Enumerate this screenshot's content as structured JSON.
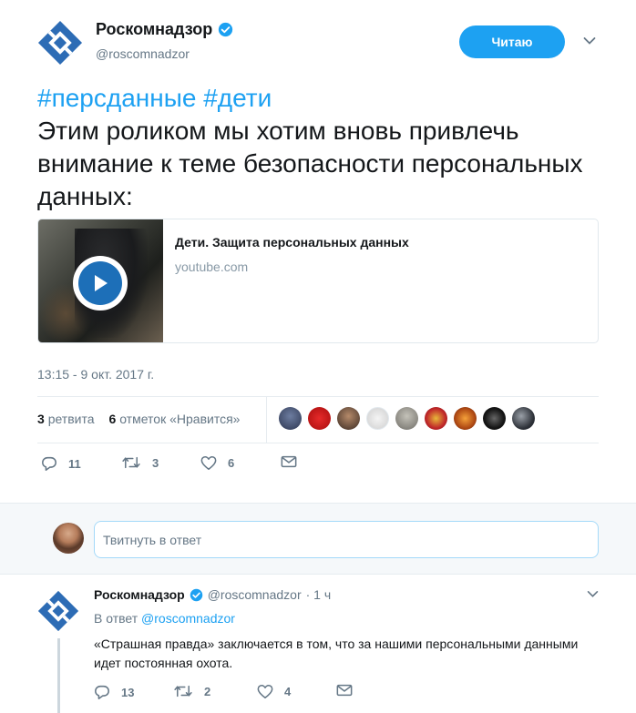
{
  "tweet": {
    "display_name": "Роскомнадзор",
    "handle": "@roscomnadzor",
    "follow_label": "Читаю",
    "hashtags": "#персданные #дети",
    "text": "Этим роликом мы хотим вновь привлечь внимание к теме безопасности персональных данных:",
    "card": {
      "title": "Дети. Защита персональных данных",
      "domain": "youtube.com"
    },
    "timestamp": "13:15 - 9 окт. 2017 г.",
    "retweets_count": "3",
    "retweets_label": "ретвита",
    "likes_count": "6",
    "likes_label": "отметок «Нравится»",
    "actions": {
      "replies": "11",
      "retweets": "3",
      "likes": "6"
    }
  },
  "reply_box": {
    "placeholder": "Твитнуть в ответ"
  },
  "reply_tweet": {
    "display_name": "Роскомнадзор",
    "handle": "@roscomnadzor",
    "time": "· 1 ч",
    "in_reply_prefix": "В ответ",
    "in_reply_handle": "@roscomnadzor",
    "text": "«Страшная правда» заключается в том, что за нашими персональными данными идет постоянная охота.",
    "actions": {
      "replies": "13",
      "retweets": "2",
      "likes": "4"
    }
  },
  "colors": {
    "accent": "#1da1f2",
    "muted": "#657786",
    "border": "#e6ecf0"
  }
}
